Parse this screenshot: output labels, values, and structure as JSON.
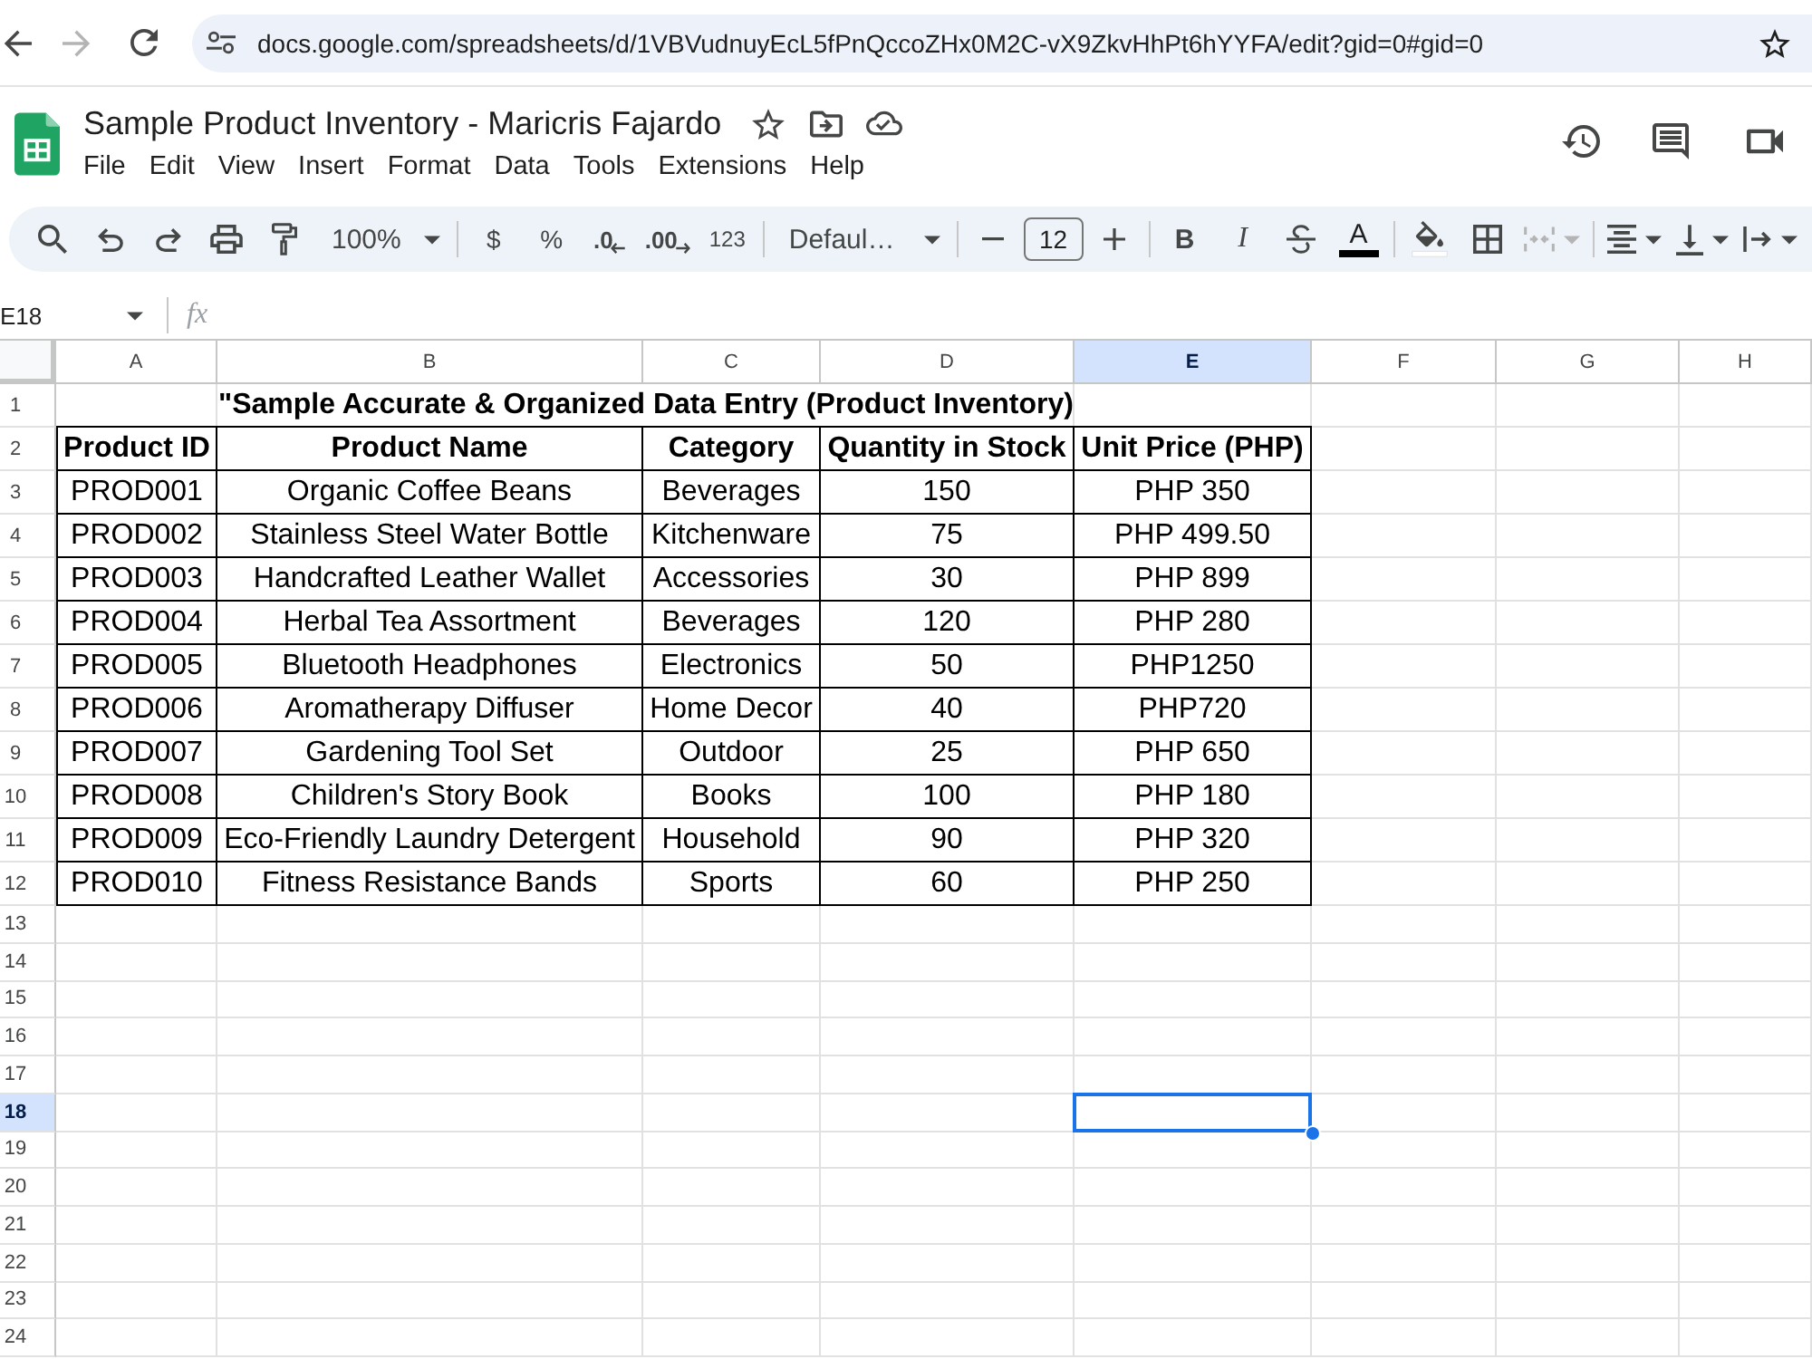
{
  "browser": {
    "url": "docs.google.com/spreadsheets/d/1VBVudnuyEcL5fPnQccoZHx0M2C-vX9ZkvHhPt6hYYFA/edit?gid=0#gid=0",
    "forward_disabled": true
  },
  "document": {
    "title": "Sample Product Inventory - Maricris Fajardo",
    "menu": [
      "File",
      "Edit",
      "View",
      "Insert",
      "Format",
      "Data",
      "Tools",
      "Extensions",
      "Help"
    ]
  },
  "toolbar": {
    "zoom": "100%",
    "currency": "$",
    "percent": "%",
    "decrease_decimal": ".0",
    "increase_decimal": ".00",
    "more_formats": "123",
    "font": "Defaul…",
    "font_size": "12",
    "bold": "B",
    "italic": "I",
    "text_color": "A",
    "merge_disabled": true
  },
  "formula_bar": {
    "name_box": "E18",
    "function_label": "fx"
  },
  "sheet": {
    "columns": [
      {
        "label": "A",
        "selected": false
      },
      {
        "label": "B",
        "selected": false
      },
      {
        "label": "C",
        "selected": false
      },
      {
        "label": "D",
        "selected": false
      },
      {
        "label": "E",
        "selected": true
      },
      {
        "label": "F",
        "selected": false
      },
      {
        "label": "G",
        "selected": false
      },
      {
        "label": "H",
        "selected": false
      }
    ],
    "rows": [
      {
        "label": "1",
        "selected": false
      },
      {
        "label": "2",
        "selected": false
      },
      {
        "label": "3",
        "selected": false
      },
      {
        "label": "4",
        "selected": false
      },
      {
        "label": "5",
        "selected": false
      },
      {
        "label": "6",
        "selected": false
      },
      {
        "label": "7",
        "selected": false
      },
      {
        "label": "8",
        "selected": false
      },
      {
        "label": "9",
        "selected": false
      },
      {
        "label": "10",
        "selected": false
      },
      {
        "label": "11",
        "selected": false
      },
      {
        "label": "12",
        "selected": false
      },
      {
        "label": "13",
        "selected": false
      },
      {
        "label": "14",
        "selected": false
      },
      {
        "label": "15",
        "selected": false
      },
      {
        "label": "16",
        "selected": false
      },
      {
        "label": "17",
        "selected": false
      },
      {
        "label": "18",
        "selected": true
      },
      {
        "label": "19",
        "selected": false
      },
      {
        "label": "20",
        "selected": false
      },
      {
        "label": "21",
        "selected": false
      },
      {
        "label": "22",
        "selected": false
      },
      {
        "label": "23",
        "selected": false
      },
      {
        "label": "24",
        "selected": false
      }
    ],
    "title": "\"Sample Accurate & Organized Data Entry (Product Inventory)",
    "table": {
      "header": [
        "Product ID",
        "Product Name",
        "Category",
        "Quantity in Stock",
        "Unit Price (PHP)"
      ],
      "rows": [
        [
          "PROD001",
          "Organic Coffee Beans",
          "Beverages",
          "150",
          "PHP 350"
        ],
        [
          "PROD002",
          "Stainless Steel Water Bottle",
          "Kitchenware",
          "75",
          "PHP 499.50"
        ],
        [
          "PROD003",
          "Handcrafted Leather Wallet",
          "Accessories",
          "30",
          "PHP 899"
        ],
        [
          "PROD004",
          "Herbal Tea Assortment",
          "Beverages",
          "120",
          "PHP 280"
        ],
        [
          "PROD005",
          "Bluetooth Headphones",
          "Electronics",
          "50",
          "PHP1250"
        ],
        [
          "PROD006",
          "Aromatherapy Diffuser",
          "Home Decor",
          "40",
          "PHP720"
        ],
        [
          "PROD007",
          "Gardening Tool Set",
          "Outdoor",
          "25",
          "PHP 650"
        ],
        [
          "PROD008",
          "Children's Story Book",
          "Books",
          "100",
          "PHP 180"
        ],
        [
          "PROD009",
          "Eco-Friendly Laundry Detergent",
          "Household",
          "90",
          "PHP 320"
        ],
        [
          "PROD010",
          "Fitness Resistance Bands",
          "Sports",
          "60",
          "PHP 250"
        ]
      ]
    }
  }
}
